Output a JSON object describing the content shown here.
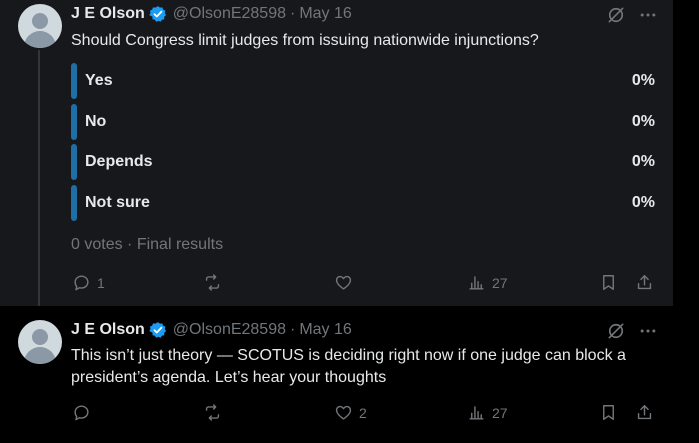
{
  "tweets": [
    {
      "author": "J E Olson",
      "handle": "@OlsonE28598",
      "separator": "·",
      "date": "May 16",
      "text": "Should Congress limit judges from issuing nationwide injunctions?",
      "poll": {
        "options": [
          {
            "label": "Yes",
            "percent": "0%"
          },
          {
            "label": "No",
            "percent": "0%"
          },
          {
            "label": "Depends",
            "percent": "0%"
          },
          {
            "label": "Not sure",
            "percent": "0%"
          }
        ],
        "votes": "0 votes",
        "status": "Final results"
      },
      "actions": {
        "replies": "1",
        "reposts": "",
        "likes": "",
        "views": "27"
      }
    },
    {
      "author": "J E Olson",
      "handle": "@OlsonE28598",
      "separator": "·",
      "date": "May 16",
      "text": "This isn’t just theory — SCOTUS is deciding right now if one judge can block a president’s agenda. Let’s hear your thoughts",
      "actions": {
        "replies": "",
        "reposts": "",
        "likes": "2",
        "views": "27"
      }
    }
  ],
  "colors": {
    "accent": "#1d9bf0",
    "poll_bar": "#1d6fa5",
    "muted_text": "#71767b",
    "primary_text": "#e7e9ea"
  },
  "icons": [
    "verified-badge-icon",
    "grok-icon",
    "more-icon",
    "reply-icon",
    "repost-icon",
    "like-icon",
    "views-icon",
    "bookmark-icon",
    "share-icon"
  ]
}
